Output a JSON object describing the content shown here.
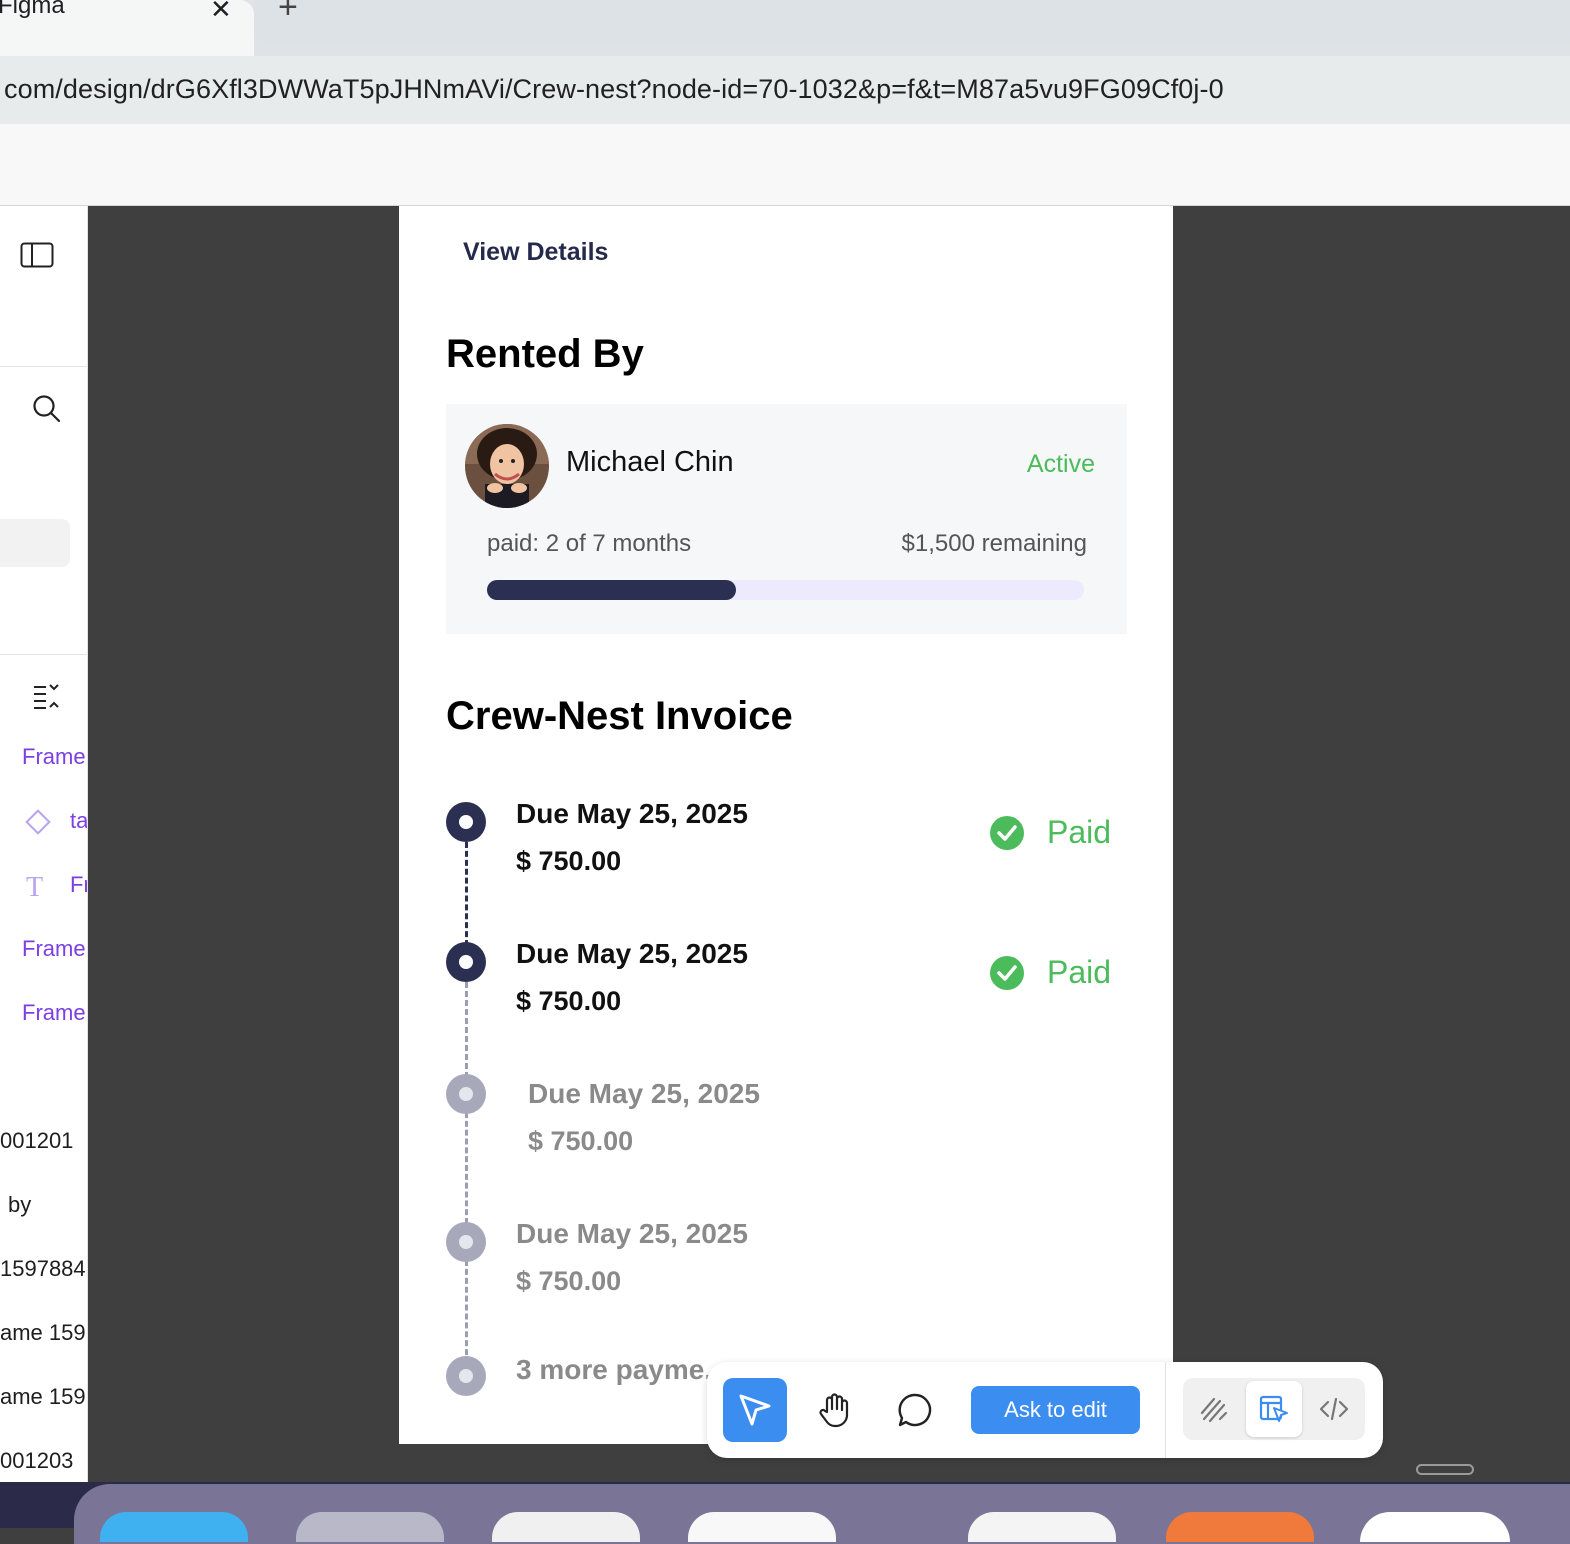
{
  "browser": {
    "tab_title": "Figma",
    "tab_close": "✕",
    "new_tab": "+",
    "url": "com/design/drG6Xfl3DWWaT5pJHNmAVi/Crew-nest?node-id=70-1032&p=f&t=M87a5vu9FG09Cf0j-0"
  },
  "left_panel": {
    "layers": [
      {
        "label": "Frame"
      },
      {
        "label": "ta"
      },
      {
        "label": "Fr"
      },
      {
        "label": "Frame"
      },
      {
        "label": "Frame"
      }
    ],
    "texts": [
      {
        "label": "001201"
      },
      {
        "label": "by"
      },
      {
        "label": "1597884"
      },
      {
        "label": "ame 159"
      },
      {
        "label": "ame 159"
      },
      {
        "label": "001203"
      }
    ]
  },
  "frame": {
    "view_details": "View Details",
    "rented_by_heading": "Rented By",
    "renter": {
      "name": "Michael Chin",
      "status": "Active",
      "paid_info": "paid: 2 of 7 months",
      "remaining": "$1,500 remaining",
      "progress_fraction": 0.4167
    },
    "invoice_heading": "Crew-Nest Invoice",
    "payments": [
      {
        "due": "Due May 25, 2025",
        "amount": "$ 750.00",
        "status": "Paid"
      },
      {
        "due": "Due May 25, 2025",
        "amount": "$ 750.00",
        "status": "Paid"
      },
      {
        "due": "Due May 25, 2025",
        "amount": "$ 750.00",
        "status": ""
      },
      {
        "due": "Due May 25, 2025",
        "amount": "$ 750.00",
        "status": ""
      }
    ],
    "more_payments": "3 more payme..."
  },
  "toolbar": {
    "ask_to_edit": "Ask to edit"
  },
  "colors": {
    "accent_blue": "#3b8df0",
    "navy": "#2b3052",
    "green": "#4cbb5b",
    "figma_purple": "#7b3fe4"
  }
}
